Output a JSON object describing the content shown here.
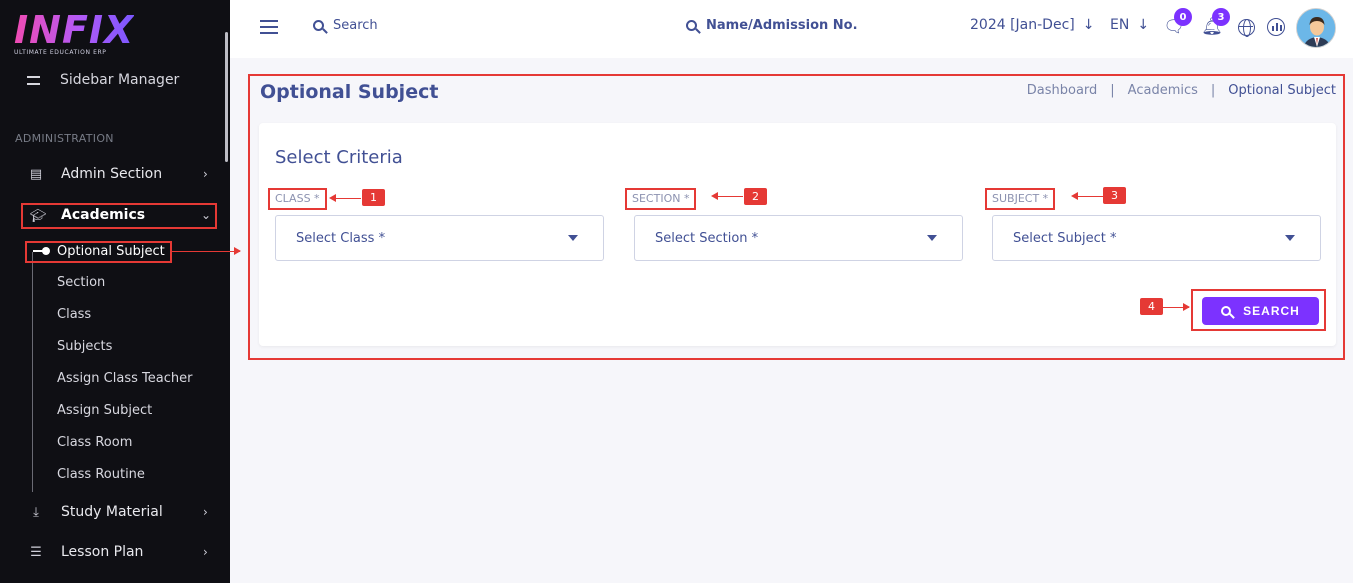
{
  "brand": {
    "logo_text": "INFIX",
    "tagline": "ULTIMATE EDUCATION ERP"
  },
  "sidebar": {
    "manager_label": "Sidebar Manager",
    "section_heading": "ADMINISTRATION",
    "items": [
      {
        "label": "Admin Section",
        "icon": "admin-icon"
      },
      {
        "label": "Academics",
        "icon": "graduation-cap-icon",
        "expanded": true
      },
      {
        "label": "Study Material",
        "icon": "download-icon"
      },
      {
        "label": "Lesson Plan",
        "icon": "list-icon"
      }
    ],
    "academics_sub": [
      "Optional Subject",
      "Section",
      "Class",
      "Subjects",
      "Assign Class Teacher",
      "Assign Subject",
      "Class Room",
      "Class Routine"
    ]
  },
  "header": {
    "search_label": "Search",
    "name_search_label": "Name/Admission No.",
    "session": "2024 [Jan-Dec]",
    "language": "EN",
    "messages_count": "0",
    "notifications_count": "3"
  },
  "page": {
    "title": "Optional Subject",
    "breadcrumbs": [
      "Dashboard",
      "Academics",
      "Optional Subject"
    ],
    "card_title": "Select Criteria",
    "fields": [
      {
        "label": "CLASS *",
        "placeholder": "Select Class *",
        "annotation": "1"
      },
      {
        "label": "SECTION *",
        "placeholder": "Select Section *",
        "annotation": "2"
      },
      {
        "label": "SUBJECT *",
        "placeholder": "Select Subject *",
        "annotation": "3"
      }
    ],
    "search_button": "SEARCH",
    "search_annotation": "4"
  },
  "colors": {
    "accent": "#7c32ff",
    "primary_text": "#415094",
    "annotation": "#e53935",
    "sidebar_bg": "#0f0f14"
  }
}
